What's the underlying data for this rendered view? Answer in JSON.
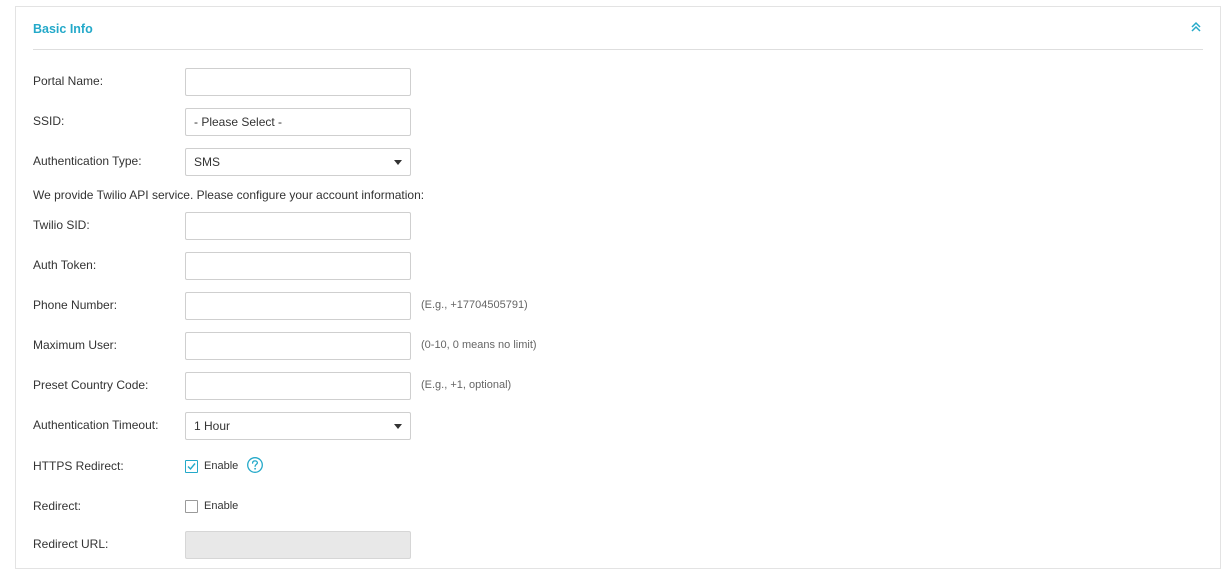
{
  "panel": {
    "title": "Basic Info",
    "collapse_icon": "double-chevron-up-icon",
    "accent_color": "#24a9c9"
  },
  "form": {
    "portal_name": {
      "label": "Portal Name:",
      "value": ""
    },
    "ssid": {
      "label": "SSID:",
      "value": "- Please Select -"
    },
    "auth_type": {
      "label": "Authentication Type:",
      "value": "SMS"
    },
    "twilio_info": "We provide Twilio API service. Please configure your account information:",
    "twilio_sid": {
      "label": "Twilio SID:",
      "value": ""
    },
    "auth_token": {
      "label": "Auth Token:",
      "value": ""
    },
    "phone_number": {
      "label": "Phone Number:",
      "value": "",
      "hint": "(E.g., +17704505791)"
    },
    "max_user": {
      "label": "Maximum User:",
      "value": "",
      "hint": "(0-10, 0 means no limit)"
    },
    "country_code": {
      "label": "Preset Country Code:",
      "value": "",
      "hint": "(E.g., +1, optional)"
    },
    "auth_timeout": {
      "label": "Authentication Timeout:",
      "value": "1 Hour"
    },
    "https_redirect": {
      "label": "HTTPS Redirect:",
      "checkbox_label": "Enable",
      "checked": true,
      "help_icon": "question-circle-icon"
    },
    "redirect": {
      "label": "Redirect:",
      "checkbox_label": "Enable",
      "checked": false
    },
    "redirect_url": {
      "label": "Redirect URL:",
      "value": "",
      "disabled": true
    }
  }
}
